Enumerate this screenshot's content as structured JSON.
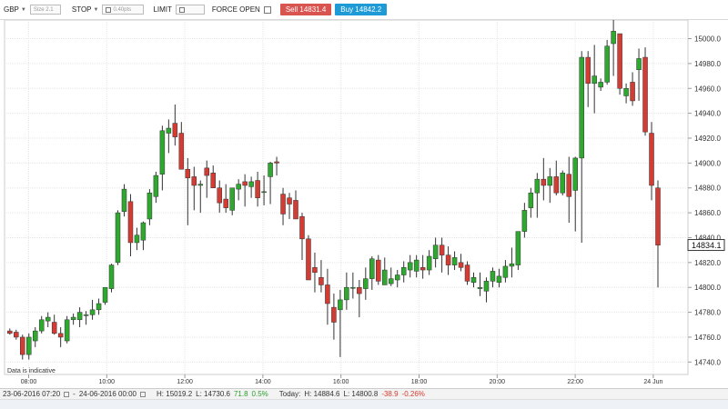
{
  "toolbar": {
    "market": "GBP",
    "size_placeholder": "Size 2.1",
    "stop_label": "STOP",
    "stop_value": "0.40pts",
    "limit_label": "LIMIT",
    "force_open_label": "FORCE OPEN",
    "sell_label": "Sell 14831.4",
    "buy_label": "Buy 14842.2"
  },
  "chart_data": {
    "type": "candlestick",
    "ylim": [
      14730,
      15015
    ],
    "yticks": [
      "15000.0",
      "14980.0",
      "14960.0",
      "14940.0",
      "14920.0",
      "14900.0",
      "14880.0",
      "14860.0",
      "14840.0",
      "14820.0",
      "14800.0",
      "14780.0",
      "14760.0",
      "14740.0"
    ],
    "xticks": [
      "08:00",
      "10:00",
      "12:00",
      "14:00",
      "16:00",
      "18:00",
      "20:00",
      "22:00",
      "24 Jun"
    ],
    "current_price": "14834.1",
    "colors": {
      "up": "#2ea82e",
      "down": "#d33b33"
    },
    "candles": [
      [
        14765,
        14767,
        14762,
        14763
      ],
      [
        14764,
        14766,
        14758,
        14760
      ],
      [
        14760,
        14762,
        14742,
        14746
      ],
      [
        14746,
        14763,
        14742,
        14760
      ],
      [
        14757,
        14768,
        14752,
        14765
      ],
      [
        14765,
        14777,
        14763,
        14774
      ],
      [
        14773,
        14780,
        14768,
        14776
      ],
      [
        14772,
        14778,
        14762,
        14763
      ],
      [
        14763,
        14768,
        14752,
        14760
      ],
      [
        14757,
        14777,
        14755,
        14774
      ],
      [
        14774,
        14779,
        14770,
        14776
      ],
      [
        14774,
        14784,
        14768,
        14780
      ],
      [
        14778,
        14781,
        14770,
        14778
      ],
      [
        14778,
        14790,
        14774,
        14782
      ],
      [
        14782,
        14791,
        14778,
        14787
      ],
      [
        14788,
        14800,
        14786,
        14800
      ],
      [
        14799,
        14819,
        14796,
        14818
      ],
      [
        14820,
        14862,
        14818,
        14860
      ],
      [
        14861,
        14883,
        14857,
        14879
      ],
      [
        14869,
        14875,
        14825,
        14836
      ],
      [
        14836,
        14848,
        14830,
        14842
      ],
      [
        14838,
        14853,
        14830,
        14852
      ],
      [
        14855,
        14879,
        14850,
        14876
      ],
      [
        14873,
        14893,
        14868,
        14890
      ],
      [
        14891,
        14930,
        14878,
        14926
      ],
      [
        14924,
        14935,
        14908,
        14928
      ],
      [
        14932,
        14947,
        14914,
        14921
      ],
      [
        14924,
        14933,
        14900,
        14895
      ],
      [
        14895,
        14904,
        14850,
        14888
      ],
      [
        14889,
        14897,
        14862,
        14882
      ],
      [
        14882,
        14886,
        14860,
        14883
      ],
      [
        14896,
        14902,
        14872,
        14890
      ],
      [
        14892,
        14898,
        14880,
        14880
      ],
      [
        14880,
        14886,
        14860,
        14868
      ],
      [
        14871,
        14883,
        14860,
        14864
      ],
      [
        14862,
        14876,
        14858,
        14880
      ],
      [
        14879,
        14887,
        14870,
        14883
      ],
      [
        14885,
        14891,
        14865,
        14882
      ],
      [
        14881,
        14889,
        14872,
        14885
      ],
      [
        14886,
        14893,
        14865,
        14872
      ],
      [
        14877,
        14890,
        14866,
        14877
      ],
      [
        14889,
        14901,
        14867,
        14900
      ],
      [
        14901,
        14905,
        14890,
        14900
      ],
      [
        14875,
        14880,
        14850,
        14859
      ],
      [
        14872,
        14876,
        14855,
        14867
      ],
      [
        14870,
        14878,
        14857,
        14855
      ],
      [
        14857,
        14860,
        14822,
        14839
      ],
      [
        14839,
        14842,
        14820,
        14806
      ],
      [
        14816,
        14828,
        14796,
        14812
      ],
      [
        14808,
        14822,
        14796,
        14802
      ],
      [
        14802,
        14815,
        14770,
        14787
      ],
      [
        14784,
        14795,
        14758,
        14772
      ],
      [
        14782,
        14798,
        14744,
        14790
      ],
      [
        14790,
        14812,
        14782,
        14800
      ],
      [
        14800,
        14812,
        14791,
        14800
      ],
      [
        14800,
        14806,
        14776,
        14795
      ],
      [
        14799,
        14816,
        14790,
        14807
      ],
      [
        14807,
        14825,
        14798,
        14823
      ],
      [
        14822,
        14826,
        14802,
        14805
      ],
      [
        14802,
        14824,
        14802,
        14814
      ],
      [
        14803,
        14816,
        14801,
        14807
      ],
      [
        14806,
        14814,
        14800,
        14810
      ],
      [
        14810,
        14821,
        14804,
        14816
      ],
      [
        14814,
        14826,
        14808,
        14820
      ],
      [
        14813,
        14826,
        14808,
        14822
      ],
      [
        14816,
        14826,
        14807,
        14814
      ],
      [
        14814,
        14830,
        14810,
        14825
      ],
      [
        14823,
        14840,
        14816,
        14834
      ],
      [
        14834,
        14840,
        14812,
        14826
      ],
      [
        14826,
        14833,
        14810,
        14818
      ],
      [
        14818,
        14829,
        14814,
        14824
      ],
      [
        14820,
        14827,
        14813,
        14816
      ],
      [
        14818,
        14821,
        14802,
        14805
      ],
      [
        14804,
        14812,
        14800,
        14808
      ],
      [
        14799,
        14812,
        14793,
        14800
      ],
      [
        14797,
        14808,
        14788,
        14805
      ],
      [
        14805,
        14816,
        14800,
        14813
      ],
      [
        14804,
        14815,
        14800,
        14809
      ],
      [
        14808,
        14822,
        14804,
        14817
      ],
      [
        14817,
        14832,
        14808,
        14819
      ],
      [
        14818,
        14837,
        14814,
        14845
      ],
      [
        14845,
        14868,
        14840,
        14862
      ],
      [
        14864,
        14880,
        14856,
        14876
      ],
      [
        14876,
        14892,
        14856,
        14887
      ],
      [
        14887,
        14904,
        14870,
        14882
      ],
      [
        14882,
        14896,
        14868,
        14889
      ],
      [
        14889,
        14902,
        14874,
        14876
      ],
      [
        14876,
        14894,
        14874,
        14892
      ],
      [
        14891,
        14905,
        14852,
        14873
      ],
      [
        14878,
        14905,
        14845,
        14904
      ],
      [
        14904,
        14990,
        14836,
        14985
      ],
      [
        14985,
        14990,
        14945,
        14964
      ],
      [
        14964,
        14995,
        14940,
        14970
      ],
      [
        14961,
        14968,
        14958,
        14965
      ],
      [
        14965,
        14999,
        14963,
        14994
      ],
      [
        14996,
        15018,
        14970,
        15006
      ],
      [
        15004,
        15004,
        14955,
        14960
      ],
      [
        14954,
        14964,
        14948,
        14960
      ],
      [
        14965,
        14973,
        14946,
        14950
      ],
      [
        14975,
        14992,
        14950,
        14984
      ],
      [
        14985,
        14993,
        14922,
        14925
      ],
      [
        14924,
        14933,
        14870,
        14882
      ],
      [
        14880,
        14886,
        14800,
        14834
      ]
    ]
  },
  "status": {
    "from": "23-06-2016 07:20",
    "to": "24-06-2016 00:00",
    "high": "H: 15019.2",
    "low": "L: 14730.6",
    "change": "71.8",
    "change_pct": "0.5%",
    "today_label": "Today:",
    "today_high": "H: 14884.6",
    "today_low": "L: 14800.8",
    "today_change": "-38.9",
    "today_change_pct": "-0.26%"
  },
  "indicative_note": "Data is indicative"
}
